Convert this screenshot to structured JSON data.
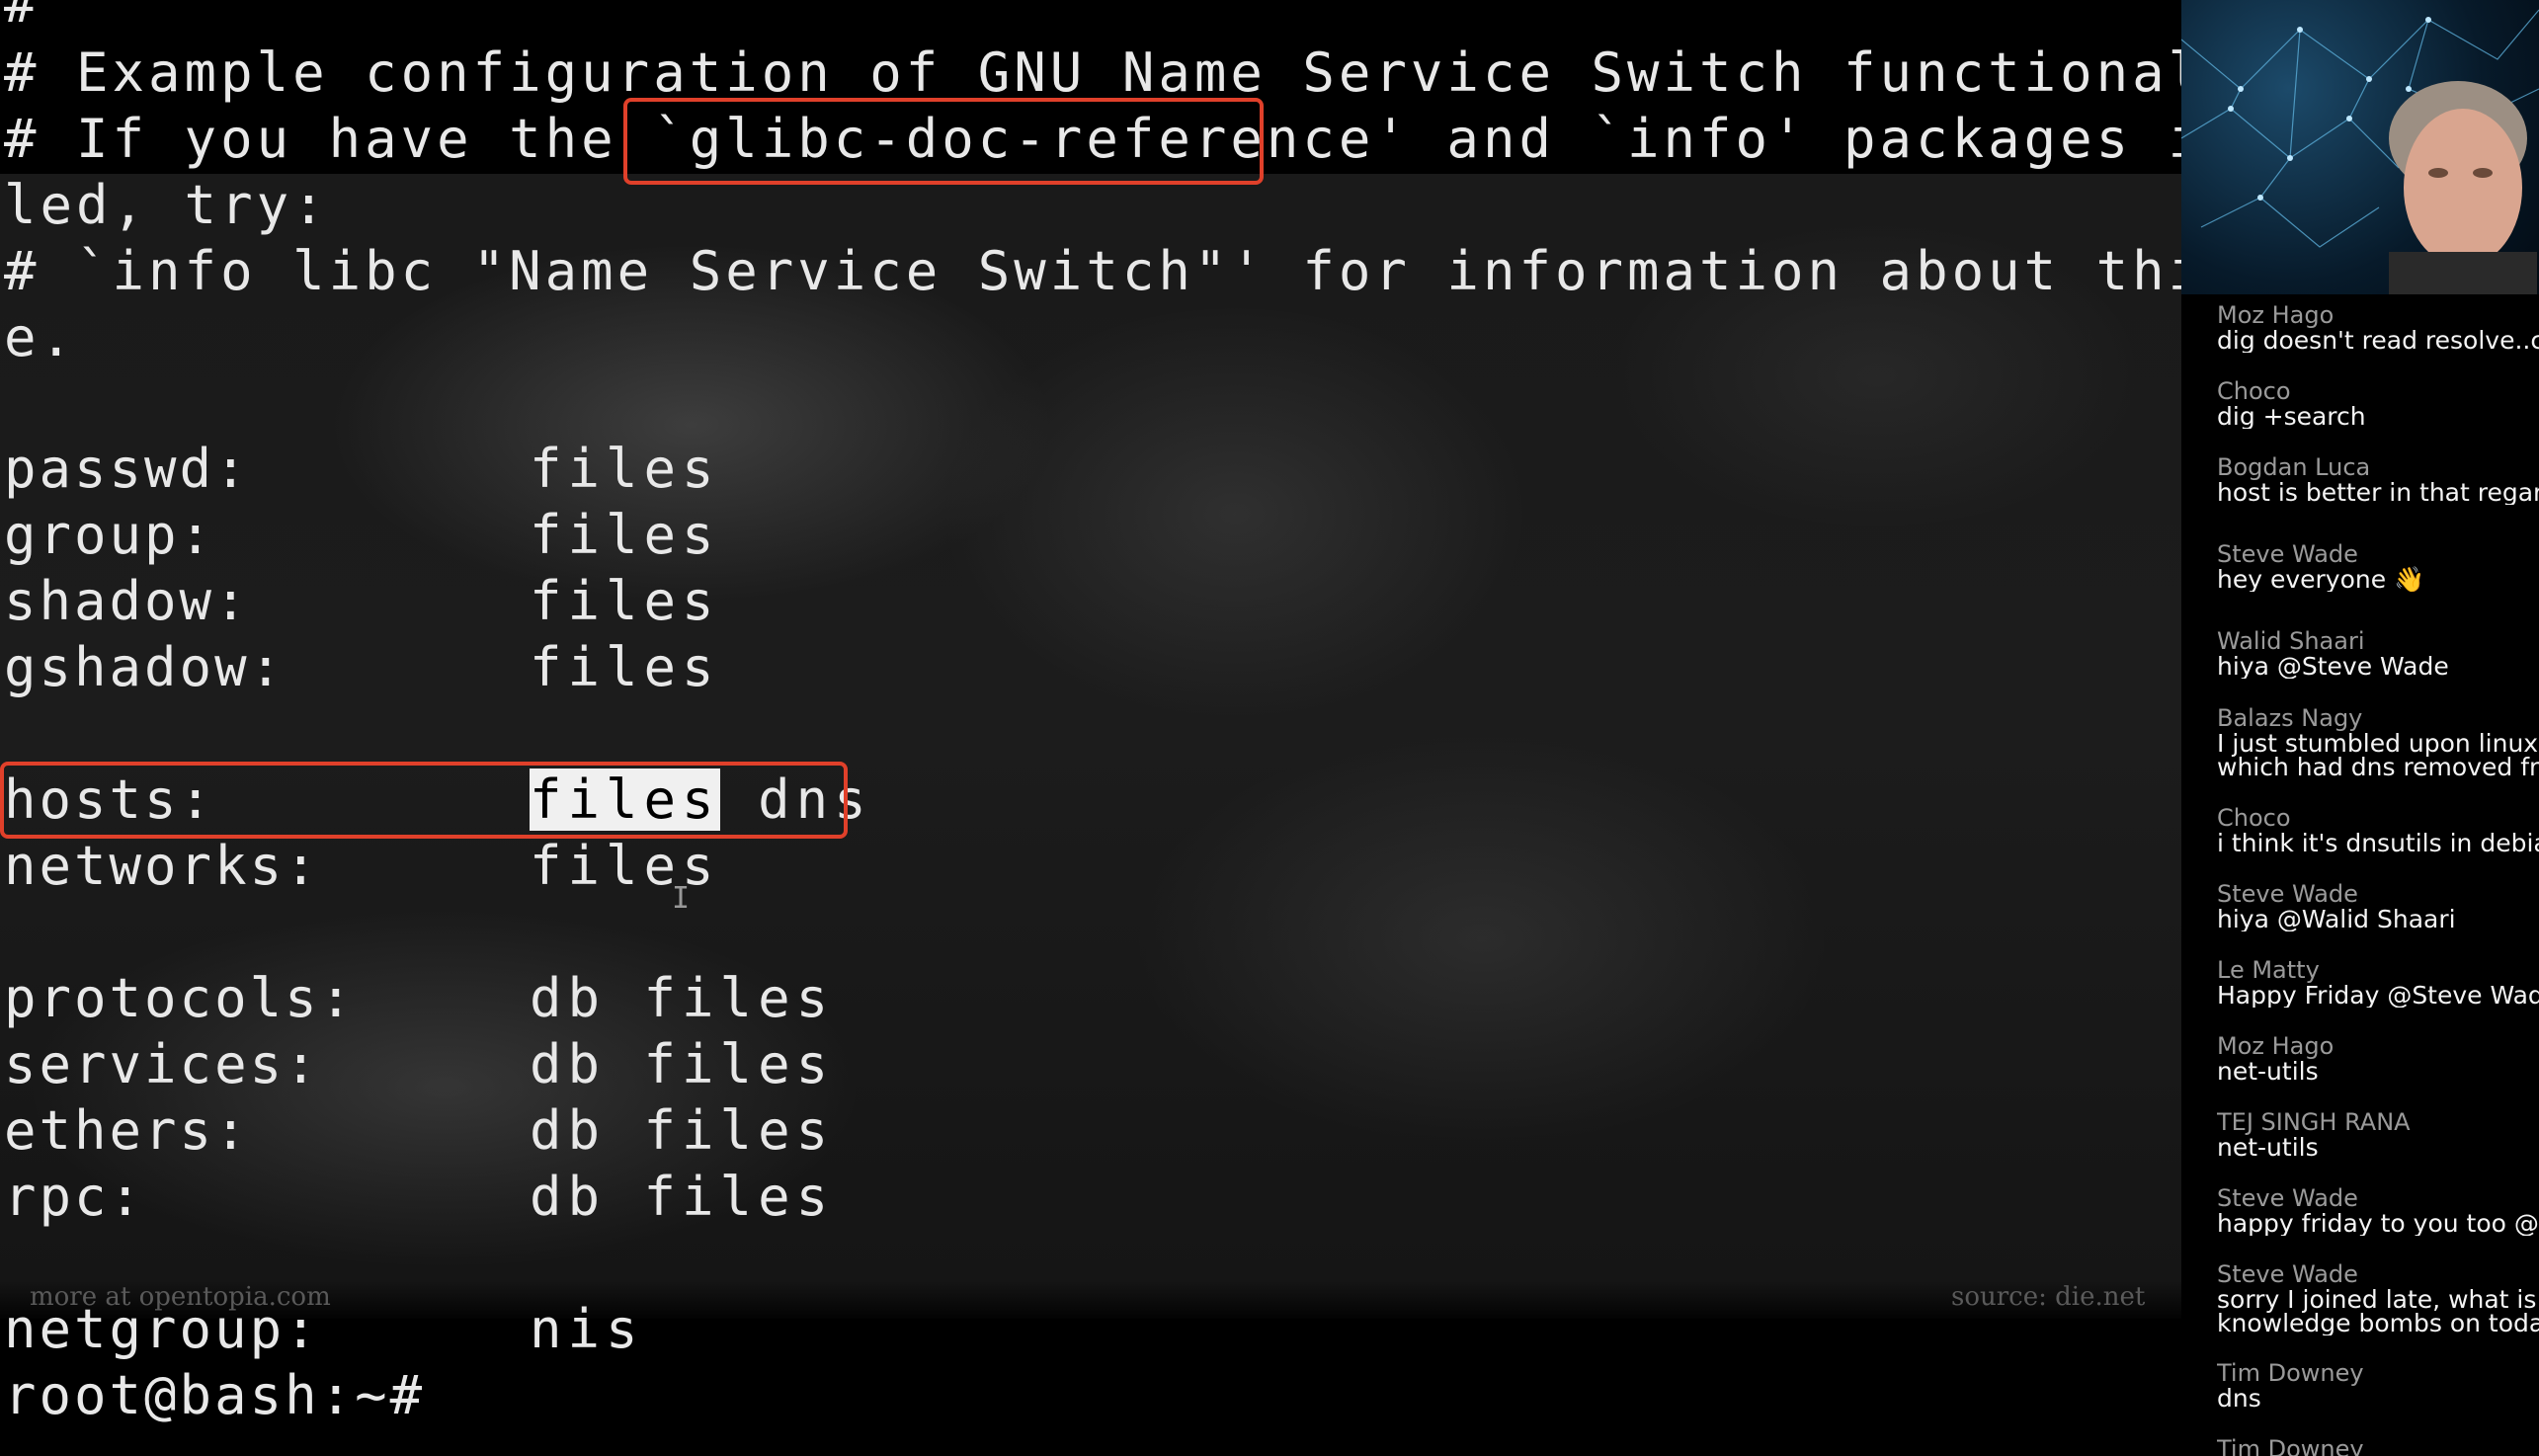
{
  "terminal": {
    "header_lines": [
      "#",
      "# Example configuration of GNU Name Service Switch functionality.",
      "# If you have the `glibc-doc-reference' and `info' packages instal",
      "led, try:",
      "# `info libc \"Name Service Switch\"' for information about this fil",
      "e."
    ],
    "entries": [
      {
        "key": "passwd:",
        "value": "files"
      },
      {
        "key": "group:",
        "value": "files"
      },
      {
        "key": "shadow:",
        "value": "files"
      },
      {
        "key": "gshadow:",
        "value": "files"
      },
      {
        "key": "hosts:",
        "value_selected": "files",
        "value_rest": " dns"
      },
      {
        "key": "networks:",
        "value": "files"
      },
      {
        "key": "protocols:",
        "value": "db files"
      },
      {
        "key": "services:",
        "value": "db files"
      },
      {
        "key": "ethers:",
        "value": "db files"
      },
      {
        "key": "rpc:",
        "value": "db files"
      },
      {
        "key": "netgroup:",
        "value": "nis"
      }
    ],
    "prompt": "root@bash:~#",
    "watermark_left": "more at opentopia.com",
    "watermark_right": "source: die.net",
    "highlight_color": "#e0402a"
  },
  "chat": {
    "messages": [
      {
        "name": "Moz Hago",
        "text": "dig doesn't read resolve..co"
      },
      {
        "name": "Choco",
        "text": "dig +search"
      },
      {
        "name": "Bogdan Luca",
        "text": "host is better in that regard"
      },
      {
        "name": "Steve Wade",
        "text": "hey everyone 👋"
      },
      {
        "name": "Walid Shaari",
        "text": "hiya @Steve Wade"
      },
      {
        "name": "Balazs Nagy",
        "text": "I just stumbled upon linux b",
        "text2": "which had dns removed fro"
      },
      {
        "name": "Choco",
        "text": "i think it's dnsutils in debian"
      },
      {
        "name": "Steve Wade",
        "text": "hiya @Walid Shaari"
      },
      {
        "name": "Le Matty",
        "text": "Happy Friday @Steve Wade"
      },
      {
        "name": "Moz Hago",
        "text": "net-utils"
      },
      {
        "name": "TEJ SINGH RANA",
        "text": "net-utils"
      },
      {
        "name": "Steve Wade",
        "text": "happy friday to you too @Le"
      },
      {
        "name": "Steve Wade",
        "text": "sorry I joined late, what is D",
        "text2": "knowledge bombs on today"
      },
      {
        "name": "Tim Downey",
        "text": "dns"
      },
      {
        "name": "Tim Downey",
        "text": ""
      }
    ]
  }
}
